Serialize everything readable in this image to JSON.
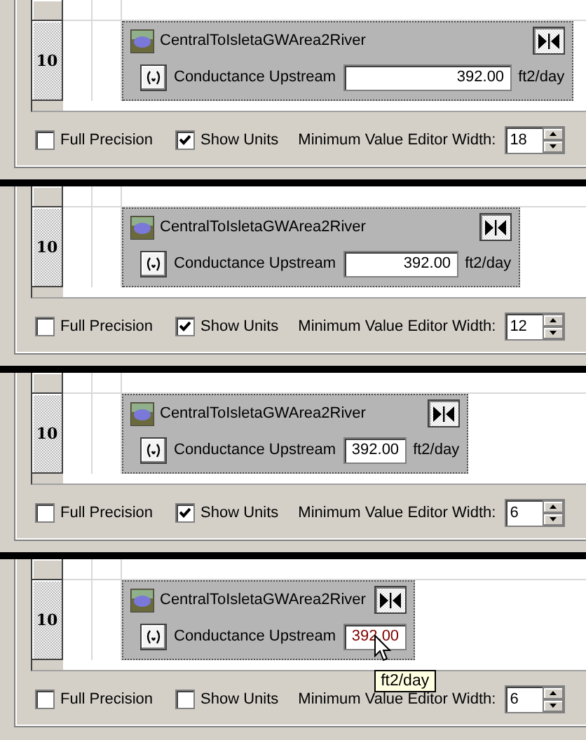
{
  "panels": [
    {
      "row_header": "10",
      "node": {
        "title": "CentralToIsletaGWArea2River",
        "slot": {
          "label": "Conductance Upstream",
          "value": "392.00",
          "units": "ft2/day"
        }
      },
      "cursor": false,
      "options": {
        "full_precision": {
          "label": "Full Precision",
          "checked": false
        },
        "show_units": {
          "label": "Show Units",
          "checked": true
        },
        "min_width": {
          "label": "Minimum Value Editor Width:",
          "value": "18"
        }
      }
    },
    {
      "row_header": "10",
      "node": {
        "title": "CentralToIsletaGWArea2River",
        "slot": {
          "label": "Conductance Upstream",
          "value": "392.00",
          "units": "ft2/day"
        }
      },
      "cursor": false,
      "options": {
        "full_precision": {
          "label": "Full Precision",
          "checked": false
        },
        "show_units": {
          "label": "Show Units",
          "checked": true
        },
        "min_width": {
          "label": "Minimum Value Editor Width:",
          "value": "12"
        }
      }
    },
    {
      "row_header": "10",
      "node": {
        "title": "CentralToIsletaGWArea2River",
        "slot": {
          "label": "Conductance Upstream",
          "value": "392.00",
          "units": "ft2/day"
        }
      },
      "cursor": false,
      "options": {
        "full_precision": {
          "label": "Full Precision",
          "checked": false
        },
        "show_units": {
          "label": "Show Units",
          "checked": true
        },
        "min_width": {
          "label": "Minimum Value Editor Width:",
          "value": "6"
        }
      }
    },
    {
      "row_header": "10",
      "node": {
        "title": "CentralToIsletaGWArea2River",
        "slot": {
          "label": "Conductance Upstream",
          "value": "392.00"
        }
      },
      "tooltip": "ft2/day",
      "cursor": true,
      "options": {
        "full_precision": {
          "label": "Full Precision",
          "checked": false
        },
        "show_units": {
          "label": "Show Units",
          "checked": false
        },
        "min_width": {
          "label": "Minimum Value Editor Width:",
          "value": "6"
        }
      }
    }
  ]
}
